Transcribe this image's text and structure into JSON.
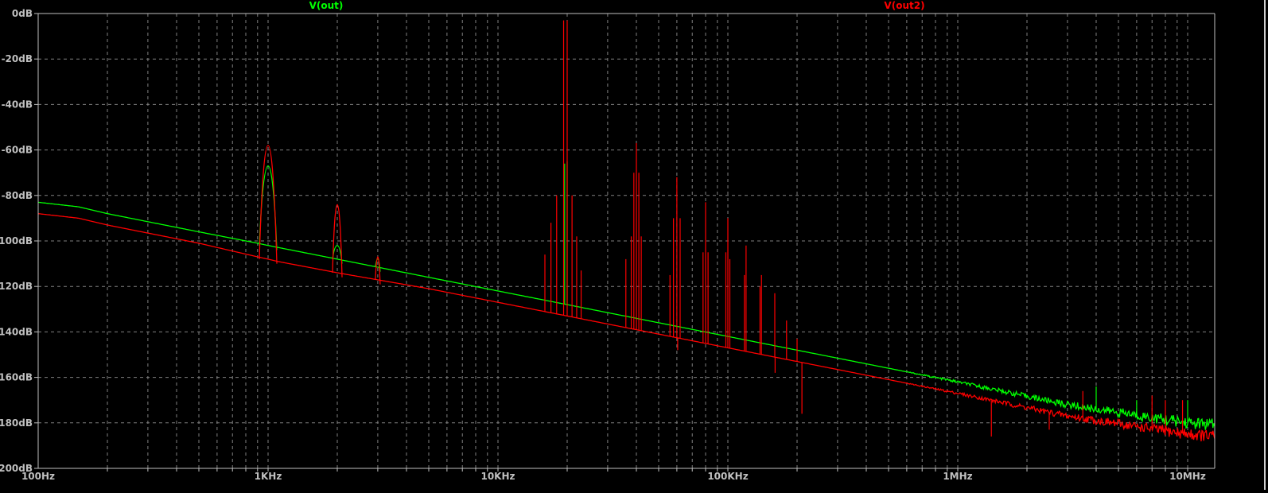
{
  "chart_data": {
    "type": "line",
    "title": "",
    "xlabel": "",
    "ylabel": "",
    "xscale": "log",
    "xlim": [
      100,
      13100000
    ],
    "ylim": [
      -200,
      0
    ],
    "grid": true,
    "legend": "top",
    "x_ticks": [
      {
        "value": 100,
        "label": "100Hz"
      },
      {
        "value": 1000,
        "label": "1KHz"
      },
      {
        "value": 10000,
        "label": "10KHz"
      },
      {
        "value": 100000,
        "label": "100KHz"
      },
      {
        "value": 1000000,
        "label": "1MHz"
      },
      {
        "value": 10000000,
        "label": "10MHz"
      }
    ],
    "y_ticks": [
      {
        "value": 0,
        "label": "0dB"
      },
      {
        "value": -20,
        "label": "-20dB"
      },
      {
        "value": -40,
        "label": "-40dB"
      },
      {
        "value": -60,
        "label": "-60dB"
      },
      {
        "value": -80,
        "label": "-80dB"
      },
      {
        "value": -100,
        "label": "-100dB"
      },
      {
        "value": -120,
        "label": "-120dB"
      },
      {
        "value": -140,
        "label": "-140dB"
      },
      {
        "value": -160,
        "label": "-160dB"
      },
      {
        "value": -180,
        "label": "-180dB"
      },
      {
        "value": -200,
        "label": "-200dB"
      }
    ],
    "series": [
      {
        "name": "V(out)",
        "color": "#00ff00",
        "floor": [
          [
            100,
            -83
          ],
          [
            150,
            -85
          ],
          [
            200,
            -88
          ],
          [
            500,
            -96
          ],
          [
            900,
            -101
          ],
          [
            1000,
            -102
          ],
          [
            2000,
            -108
          ],
          [
            5000,
            -116
          ],
          [
            10000,
            -122
          ],
          [
            20000,
            -128
          ],
          [
            100000,
            -142
          ],
          [
            1000000,
            -162
          ],
          [
            3000000,
            -172
          ],
          [
            10000000,
            -180
          ],
          [
            13100000,
            -181
          ]
        ],
        "peaks": [
          [
            1000,
            -67
          ],
          [
            2000,
            -102
          ],
          [
            3000,
            -108
          ],
          [
            20000,
            -65
          ],
          [
            19500,
            -66
          ],
          [
            1400000,
            -165
          ],
          [
            4000000,
            -164
          ],
          [
            10000000,
            -170
          ],
          [
            6000000,
            -170
          ]
        ]
      },
      {
        "name": "V(out2)",
        "color": "#ff0000",
        "floor": [
          [
            100,
            -88
          ],
          [
            150,
            -90
          ],
          [
            200,
            -93
          ],
          [
            500,
            -101
          ],
          [
            900,
            -107
          ],
          [
            1000,
            -108
          ],
          [
            1100,
            -109
          ],
          [
            2000,
            -114
          ],
          [
            5000,
            -121
          ],
          [
            10000,
            -127
          ],
          [
            20000,
            -133
          ],
          [
            100000,
            -147
          ],
          [
            1000000,
            -167
          ],
          [
            3000000,
            -177
          ],
          [
            10000000,
            -185
          ],
          [
            13100000,
            -186
          ]
        ],
        "peaks": [
          [
            1000,
            -58
          ],
          [
            2000,
            -84
          ],
          [
            3000,
            -107
          ],
          [
            17000,
            -92
          ],
          [
            18000,
            -80
          ],
          [
            19300,
            -3
          ],
          [
            20000,
            -3
          ],
          [
            21000,
            -80
          ],
          [
            22000,
            -98
          ],
          [
            16000,
            -106
          ],
          [
            23000,
            -113
          ],
          [
            38000,
            -98
          ],
          [
            39000,
            -70
          ],
          [
            40000,
            -57
          ],
          [
            41000,
            -70
          ],
          [
            42000,
            -98
          ],
          [
            36000,
            -108
          ],
          [
            58000,
            -90
          ],
          [
            60000,
            -72
          ],
          [
            62000,
            -90
          ],
          [
            56000,
            -115
          ],
          [
            78000,
            -105
          ],
          [
            80000,
            -83
          ],
          [
            82000,
            -105
          ],
          [
            98000,
            -105
          ],
          [
            100000,
            -90
          ],
          [
            102000,
            -108
          ],
          [
            118000,
            -115
          ],
          [
            120000,
            -102
          ],
          [
            138000,
            -120
          ],
          [
            140000,
            -115
          ],
          [
            160000,
            -123
          ],
          [
            180000,
            -135
          ],
          [
            200000,
            -143
          ],
          [
            210000,
            -176
          ],
          [
            160500,
            -158
          ],
          [
            60500,
            -148
          ],
          [
            1400000,
            -186
          ],
          [
            2500000,
            -183
          ],
          [
            3500000,
            -166
          ],
          [
            4200000,
            -180
          ],
          [
            7000000,
            -168
          ],
          [
            8000000,
            -170
          ],
          [
            9500000,
            -170
          ],
          [
            11000000,
            -185
          ]
        ]
      }
    ]
  }
}
